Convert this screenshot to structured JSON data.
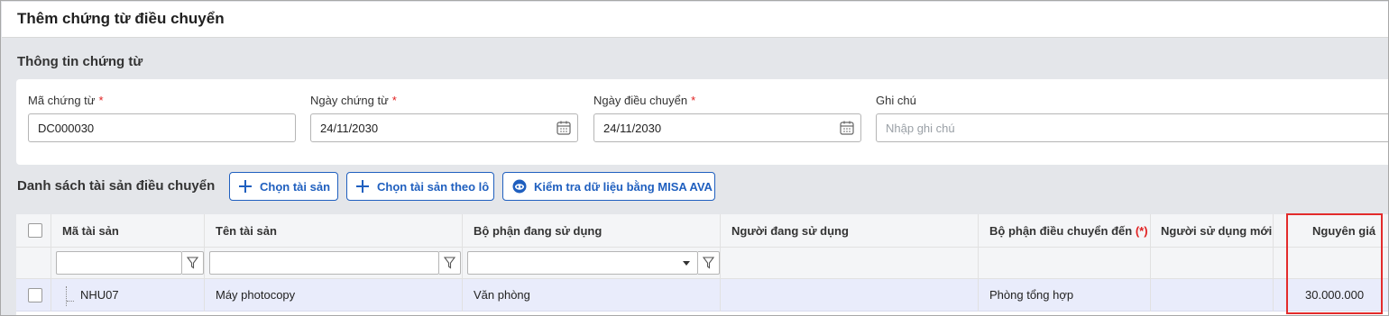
{
  "window": {
    "title": "Thêm chứng từ điều chuyển"
  },
  "info_section": {
    "title": "Thông tin chứng từ",
    "fields": {
      "voucher_no": {
        "label": "Mã chứng từ",
        "value": "DC000030"
      },
      "voucher_date": {
        "label": "Ngày chứng từ",
        "value": "24/11/2030"
      },
      "transfer_date": {
        "label": "Ngày điều chuyển",
        "value": "24/11/2030"
      },
      "note": {
        "label": "Ghi chú",
        "placeholder": "Nhập ghi chú"
      }
    },
    "required_mark": "*"
  },
  "asset_list": {
    "title": "Danh sách tài sản điều chuyển",
    "buttons": {
      "select_asset": "Chọn tài sản",
      "select_batch": "Chọn tài sản theo lô",
      "check_ava": "Kiểm tra dữ liệu bằng MISA AVA"
    },
    "columns": {
      "asset_code": "Mã tài sản",
      "asset_name": "Tên tài sản",
      "current_dept": "Bộ phận đang sử dụng",
      "current_user": "Người đang sử dụng",
      "target_dept": "Bộ phận điều chuyển đến",
      "target_dept_required": "(*)",
      "new_user": "Người sử dụng mới",
      "original_price": "Nguyên giá"
    },
    "rows": [
      {
        "asset_code": "NHU07",
        "asset_name": "Máy photocopy",
        "current_dept": "Văn phòng",
        "current_user": "",
        "target_dept": "Phòng tổng hợp",
        "new_user": "",
        "original_price": "30.000.000"
      }
    ]
  },
  "colors": {
    "accent": "#1f5fbf",
    "required": "#e02020",
    "highlight_box": "#e32b2b",
    "selected_row": "#e9ecfb"
  }
}
